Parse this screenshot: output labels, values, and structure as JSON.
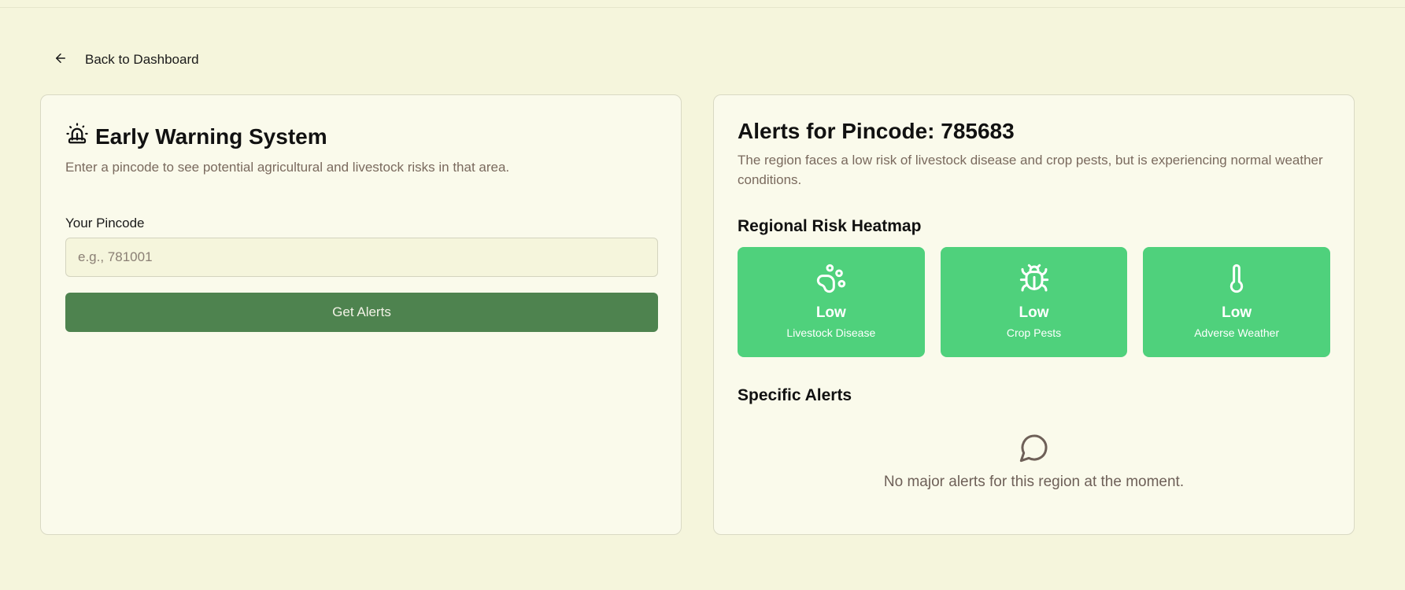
{
  "nav": {
    "back_label": "Back to Dashboard",
    "back_icon": "arrow-left-icon"
  },
  "ews": {
    "title": "Early Warning System",
    "title_icon": "siren-icon",
    "description": "Enter a pincode to see potential agricultural and livestock risks in that area.",
    "pincode_label": "Your Pincode",
    "pincode_value": "",
    "pincode_placeholder": "e.g., 781001",
    "submit_label": "Get Alerts"
  },
  "alerts": {
    "title": "Alerts for Pincode: 785683",
    "summary": "The region faces a low risk of livestock disease and crop pests, but is experiencing normal weather conditions.",
    "heatmap_title": "Regional Risk Heatmap",
    "risks": [
      {
        "level": "Low",
        "name": "Livestock Disease",
        "icon": "paw-print-icon",
        "color": "#4fd17c"
      },
      {
        "level": "Low",
        "name": "Crop Pests",
        "icon": "bug-icon",
        "color": "#4fd17c"
      },
      {
        "level": "Low",
        "name": "Adverse Weather",
        "icon": "thermometer-icon",
        "color": "#4fd17c"
      }
    ],
    "specific_title": "Specific Alerts",
    "empty_icon": "message-circle-icon",
    "empty_message": "No major alerts for this region at the moment."
  },
  "colors": {
    "background": "#f5f5dc",
    "card": "#fafaeb",
    "primary_button": "#4e834f",
    "risk_low": "#4fd17c",
    "muted_text": "#7a6a5e"
  }
}
